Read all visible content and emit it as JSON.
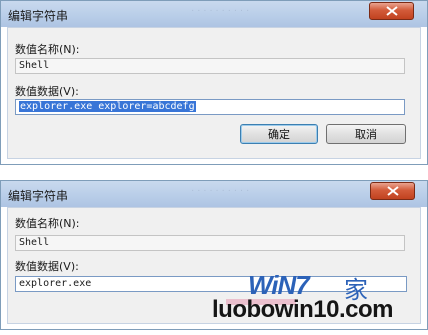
{
  "dialog1": {
    "title": "编辑字符串",
    "value_name_label": "数值名称(N):",
    "value_name": "Shell",
    "value_data_label": "数值数据(V):",
    "value_data": "explorer.exe explorer=abcdefg",
    "ok_label": "确定",
    "cancel_label": "取消"
  },
  "dialog2": {
    "title": "编辑字符串",
    "value_name_label": "数值名称(N):",
    "value_name": "Shell",
    "value_data_label": "数值数据(V):",
    "value_data": "explorer.exe"
  },
  "watermark": {
    "brand": "WiN7",
    "char": "家",
    "url": "luobowin10.com"
  },
  "icons": {
    "close": "close-icon"
  },
  "colors": {
    "titlebar": "#b8cde8",
    "close_button": "#d35b3a",
    "selection": "#3875d7",
    "client_bg": "#f0f0f0"
  }
}
